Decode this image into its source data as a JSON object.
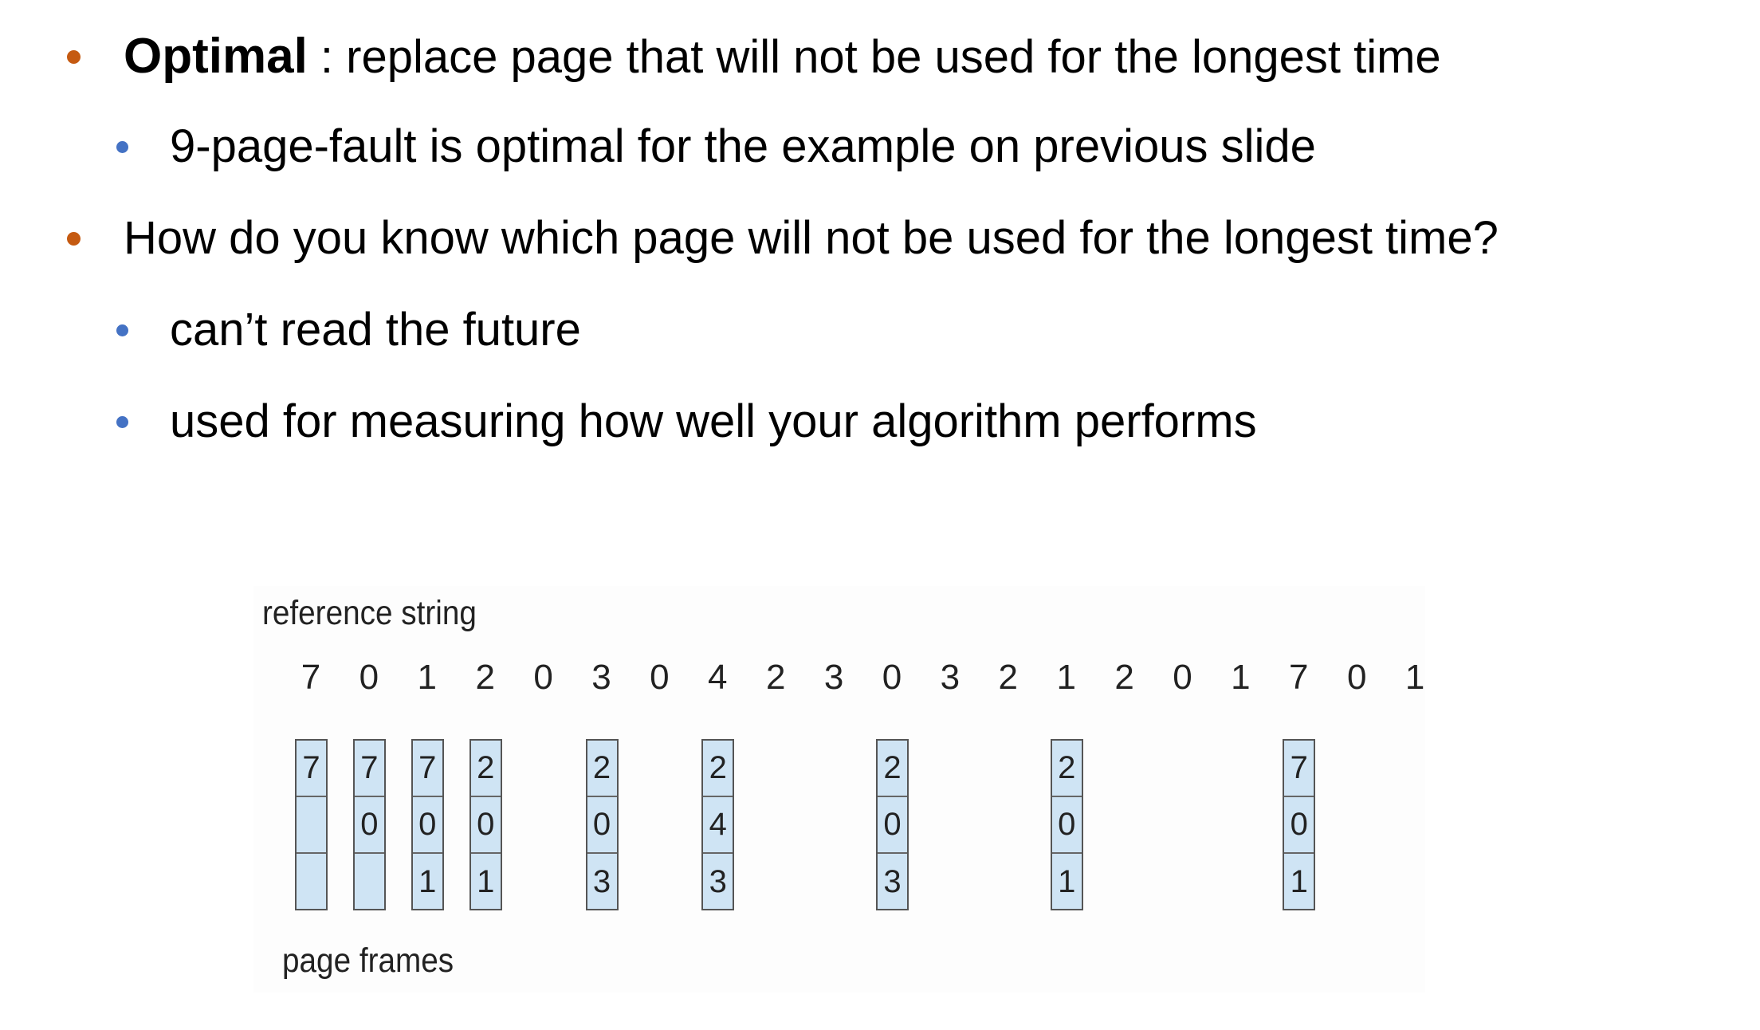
{
  "bullets": [
    {
      "level": 1,
      "bold": "Optimal",
      "text": " : replace page that will not be used for the longest time"
    },
    {
      "level": 2,
      "text": "9-page-fault is optimal for the example on previous slide"
    },
    {
      "level": 1,
      "text": "How do you know which page will not be used for the longest time?"
    },
    {
      "level": 2,
      "text": "can’t read the future"
    },
    {
      "level": 2,
      "text": "used for measuring how well your algorithm performs"
    }
  ],
  "figure": {
    "reference_label": "reference string",
    "frames_label": "page frames",
    "reference_string": [
      "7",
      "0",
      "1",
      "2",
      "0",
      "3",
      "0",
      "4",
      "2",
      "3",
      "0",
      "3",
      "2",
      "1",
      "2",
      "0",
      "1",
      "7",
      "0",
      "1"
    ],
    "frames": [
      {
        "ref_index": 0,
        "cells": [
          "7",
          "",
          ""
        ]
      },
      {
        "ref_index": 1,
        "cells": [
          "7",
          "0",
          ""
        ]
      },
      {
        "ref_index": 2,
        "cells": [
          "7",
          "0",
          "1"
        ]
      },
      {
        "ref_index": 3,
        "cells": [
          "2",
          "0",
          "1"
        ]
      },
      {
        "ref_index": 5,
        "cells": [
          "2",
          "0",
          "3"
        ]
      },
      {
        "ref_index": 7,
        "cells": [
          "2",
          "4",
          "3"
        ]
      },
      {
        "ref_index": 10,
        "cells": [
          "2",
          "0",
          "3"
        ]
      },
      {
        "ref_index": 13,
        "cells": [
          "2",
          "0",
          "1"
        ]
      },
      {
        "ref_index": 17,
        "cells": [
          "7",
          "0",
          "1"
        ]
      }
    ]
  },
  "colors": {
    "bullet_level1": "#c55a11",
    "bullet_level2": "#4472c4",
    "frame_fill": "#cfe4f4"
  }
}
